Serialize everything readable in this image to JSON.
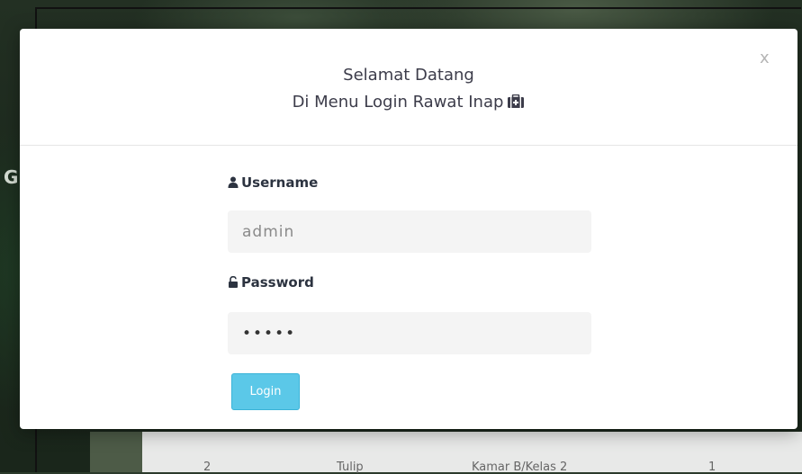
{
  "background": {
    "partial_letter": "G",
    "table_row": {
      "cells": [
        "2",
        "Tulip",
        "Kamar B/Kelas 2",
        "1"
      ]
    }
  },
  "modal": {
    "title_line1": "Selamat Datang",
    "title_line2": "Di Menu Login Rawat Inap",
    "close_label": "x",
    "username": {
      "label": "Username",
      "value": "admin",
      "icon": "user-icon"
    },
    "password": {
      "label": "Password",
      "value": "•••••",
      "icon": "lock-icon"
    },
    "login_label": "Login"
  },
  "colors": {
    "accent_button": "#5bc8e8",
    "title_text": "#3c3c4a"
  }
}
